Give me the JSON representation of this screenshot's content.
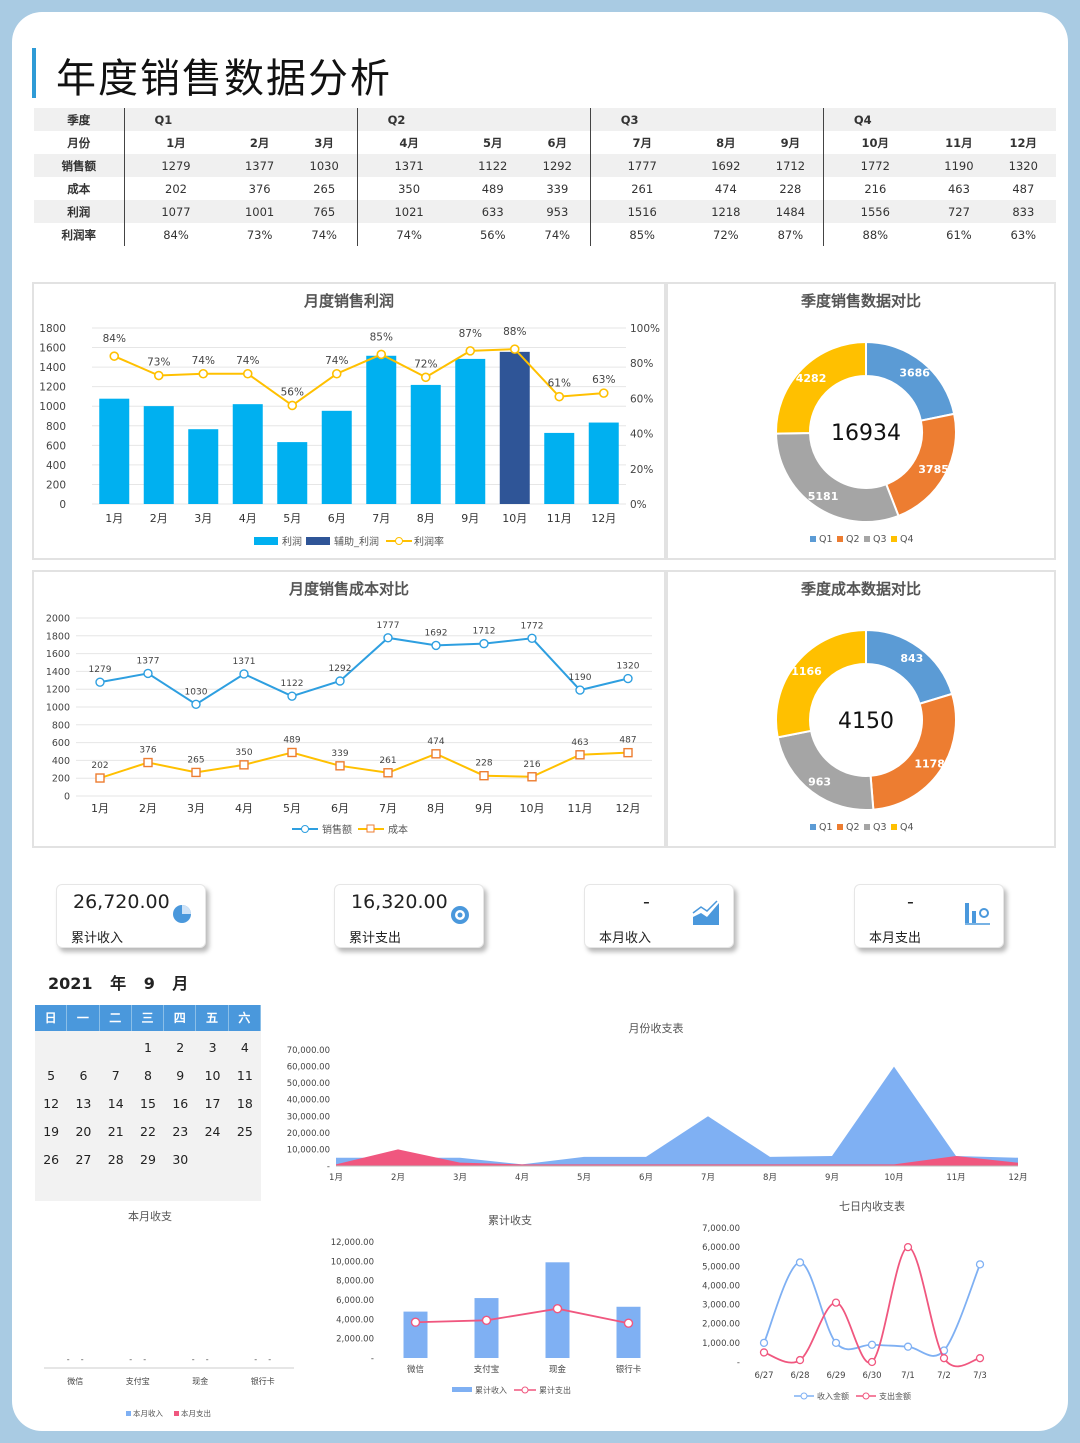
{
  "title": "年度销售数据分析",
  "table": {
    "row_labels": [
      "季度",
      "月份",
      "销售额",
      "成本",
      "利润",
      "利润率"
    ],
    "quarters": [
      "Q1",
      "Q2",
      "Q3",
      "Q4"
    ],
    "months": [
      "1月",
      "2月",
      "3月",
      "4月",
      "5月",
      "6月",
      "7月",
      "8月",
      "9月",
      "10月",
      "11月",
      "12月"
    ],
    "sales": [
      "1279",
      "1377",
      "1030",
      "1371",
      "1122",
      "1292",
      "1777",
      "1692",
      "1712",
      "1772",
      "1190",
      "1320"
    ],
    "cost": [
      "202",
      "376",
      "265",
      "350",
      "489",
      "339",
      "261",
      "474",
      "228",
      "216",
      "463",
      "487"
    ],
    "profit": [
      "1077",
      "1001",
      "765",
      "1021",
      "633",
      "953",
      "1516",
      "1218",
      "1484",
      "1556",
      "727",
      "833"
    ],
    "margin": [
      "84%",
      "73%",
      "74%",
      "74%",
      "56%",
      "74%",
      "85%",
      "72%",
      "87%",
      "88%",
      "61%",
      "63%"
    ]
  },
  "colors": {
    "profit": "#00b0f0",
    "helper": "#2f5597",
    "rate": "#f4b183",
    "rate_line": "#ffc000",
    "q1": "#5b9bd5",
    "q2": "#ed7d31",
    "q3": "#a5a5a5",
    "q4": "#ffc000",
    "sales_line": "#2e9fe0",
    "cost_line": "#ffc000",
    "area_income": "#7fb0f3",
    "area_expense": "#f0577f"
  },
  "chart_data": [
    {
      "type": "bar",
      "title": "月度销售利润",
      "categories": [
        "1月",
        "2月",
        "3月",
        "4月",
        "5月",
        "6月",
        "7月",
        "8月",
        "9月",
        "10月",
        "11月",
        "12月"
      ],
      "series": [
        {
          "name": "利润",
          "values": [
            1077,
            1001,
            765,
            1021,
            633,
            953,
            1516,
            1218,
            1484,
            null,
            727,
            833
          ]
        },
        {
          "name": "辅助_利润",
          "values": [
            null,
            null,
            null,
            null,
            null,
            null,
            null,
            null,
            null,
            1556,
            null,
            null
          ]
        },
        {
          "name": "利润率",
          "values": [
            84,
            73,
            74,
            74,
            56,
            74,
            85,
            72,
            87,
            88,
            61,
            63
          ]
        }
      ],
      "rate_labels": [
        "84%",
        "73%",
        "74%",
        "74%",
        "56%",
        "74%",
        "85%",
        "72%",
        "87%",
        "88%",
        "61%",
        "63%"
      ],
      "ylim": [
        0,
        1800
      ],
      "y_ticks": [
        "0",
        "200",
        "400",
        "600",
        "800",
        "1000",
        "1200",
        "1400",
        "1600",
        "1800"
      ],
      "y2lim": [
        0,
        100
      ],
      "y2_ticks": [
        "0%",
        "20%",
        "40%",
        "60%",
        "80%",
        "100%"
      ],
      "legend": "bottom"
    },
    {
      "type": "pie",
      "title": "季度销售数据对比",
      "center_label": "16934",
      "labels": [
        "Q1",
        "Q2",
        "Q3",
        "Q4"
      ],
      "values": [
        3686,
        3785,
        5181,
        4282
      ],
      "legend": "bottom"
    },
    {
      "type": "line",
      "title": "月度销售成本对比",
      "categories": [
        "1月",
        "2月",
        "3月",
        "4月",
        "5月",
        "6月",
        "7月",
        "8月",
        "9月",
        "10月",
        "11月",
        "12月"
      ],
      "series": [
        {
          "name": "销售额",
          "values": [
            1279,
            1377,
            1030,
            1371,
            1122,
            1292,
            1777,
            1692,
            1712,
            1772,
            1190,
            1320
          ]
        },
        {
          "name": "成本",
          "values": [
            202,
            376,
            265,
            350,
            489,
            339,
            261,
            474,
            228,
            216,
            463,
            487
          ]
        }
      ],
      "ylim": [
        0,
        2000
      ],
      "y_ticks": [
        "0",
        "200",
        "400",
        "600",
        "800",
        "1000",
        "1200",
        "1400",
        "1600",
        "1800",
        "2000"
      ],
      "legend": "bottom"
    },
    {
      "type": "pie",
      "title": "季度成本数据对比",
      "center_label": "4150",
      "labels": [
        "Q1",
        "Q2",
        "Q3",
        "Q4"
      ],
      "values": [
        843,
        1178,
        963,
        1166
      ],
      "legend": "bottom"
    },
    {
      "type": "area",
      "title": "月份收支表",
      "categories": [
        "1月",
        "2月",
        "3月",
        "4月",
        "5月",
        "6月",
        "7月",
        "8月",
        "9月",
        "10月",
        "11月",
        "12月"
      ],
      "series": [
        {
          "name": "收入金额",
          "values": [
            5000,
            5000,
            5000,
            1000,
            5500,
            5500,
            30000,
            5500,
            6000,
            60000,
            6000,
            5000
          ]
        },
        {
          "name": "支出金额",
          "values": [
            1000,
            10000,
            2000,
            1000,
            1000,
            1000,
            1000,
            1000,
            1000,
            1000,
            6000,
            2000
          ]
        }
      ],
      "ylim": [
        0,
        70000
      ],
      "y_ticks": [
        "-",
        "10,000.00",
        "20,000.00",
        "30,000.00",
        "40,000.00",
        "50,000.00",
        "60,000.00",
        "70,000.00"
      ],
      "legend": "bottom"
    },
    {
      "type": "bar",
      "title": "本月收支",
      "categories": [
        "微信",
        "支付宝",
        "现金",
        "银行卡"
      ],
      "series": [
        {
          "name": "本月收入",
          "values": [
            0,
            0,
            0,
            0
          ]
        },
        {
          "name": "本月支出",
          "values": [
            0,
            0,
            0,
            0
          ]
        }
      ],
      "value_labels": [
        "-",
        "-",
        "-",
        "-",
        "-",
        "-",
        "-",
        "-"
      ],
      "legend": "bottom"
    },
    {
      "type": "bar",
      "title": "累计收支",
      "categories": [
        "微信",
        "支付宝",
        "现金",
        "银行卡"
      ],
      "series": [
        {
          "name": "累计收入",
          "values": [
            4800,
            6200,
            9900,
            5300
          ]
        },
        {
          "name": "累计支出",
          "values": [
            3700,
            3900,
            5100,
            3600
          ]
        }
      ],
      "ylim": [
        0,
        12000
      ],
      "y_ticks": [
        "-",
        "2,000.00",
        "4,000.00",
        "6,000.00",
        "8,000.00",
        "10,000.00",
        "12,000.00"
      ],
      "legend": "bottom"
    },
    {
      "type": "line",
      "title": "七日内收支表",
      "categories": [
        "6/27",
        "6/28",
        "6/29",
        "6/30",
        "7/1",
        "7/2",
        "7/3"
      ],
      "series": [
        {
          "name": "收入金额",
          "values": [
            1000,
            5200,
            1000,
            900,
            800,
            600,
            5100
          ]
        },
        {
          "name": "支出金额",
          "values": [
            500,
            100,
            3100,
            0,
            6000,
            200,
            200
          ]
        }
      ],
      "ylim": [
        0,
        7000
      ],
      "y_ticks": [
        "-",
        "1,000.00",
        "2,000.00",
        "3,000.00",
        "4,000.00",
        "5,000.00",
        "6,000.00",
        "7,000.00"
      ],
      "legend": "bottom"
    }
  ],
  "cards": [
    {
      "value": "26,720.00",
      "label": "累计收入",
      "icon": "pie-icon"
    },
    {
      "value": "16,320.00",
      "label": "累计支出",
      "icon": "money-bag-icon"
    },
    {
      "value": "-",
      "label": "本月收入",
      "icon": "trend-chart-icon"
    },
    {
      "value": "-",
      "label": "本月支出",
      "icon": "bar-chart-icon"
    }
  ],
  "calendar": {
    "year": "2021",
    "year_unit": "年",
    "month": "9",
    "month_unit": "月",
    "weekdays": [
      "日",
      "一",
      "二",
      "三",
      "四",
      "五",
      "六"
    ],
    "days": [
      "",
      "",
      "",
      "1",
      "2",
      "3",
      "4",
      "5",
      "6",
      "7",
      "8",
      "9",
      "10",
      "11",
      "12",
      "13",
      "14",
      "15",
      "16",
      "17",
      "18",
      "19",
      "20",
      "21",
      "22",
      "23",
      "24",
      "25",
      "26",
      "27",
      "28",
      "29",
      "30"
    ]
  }
}
